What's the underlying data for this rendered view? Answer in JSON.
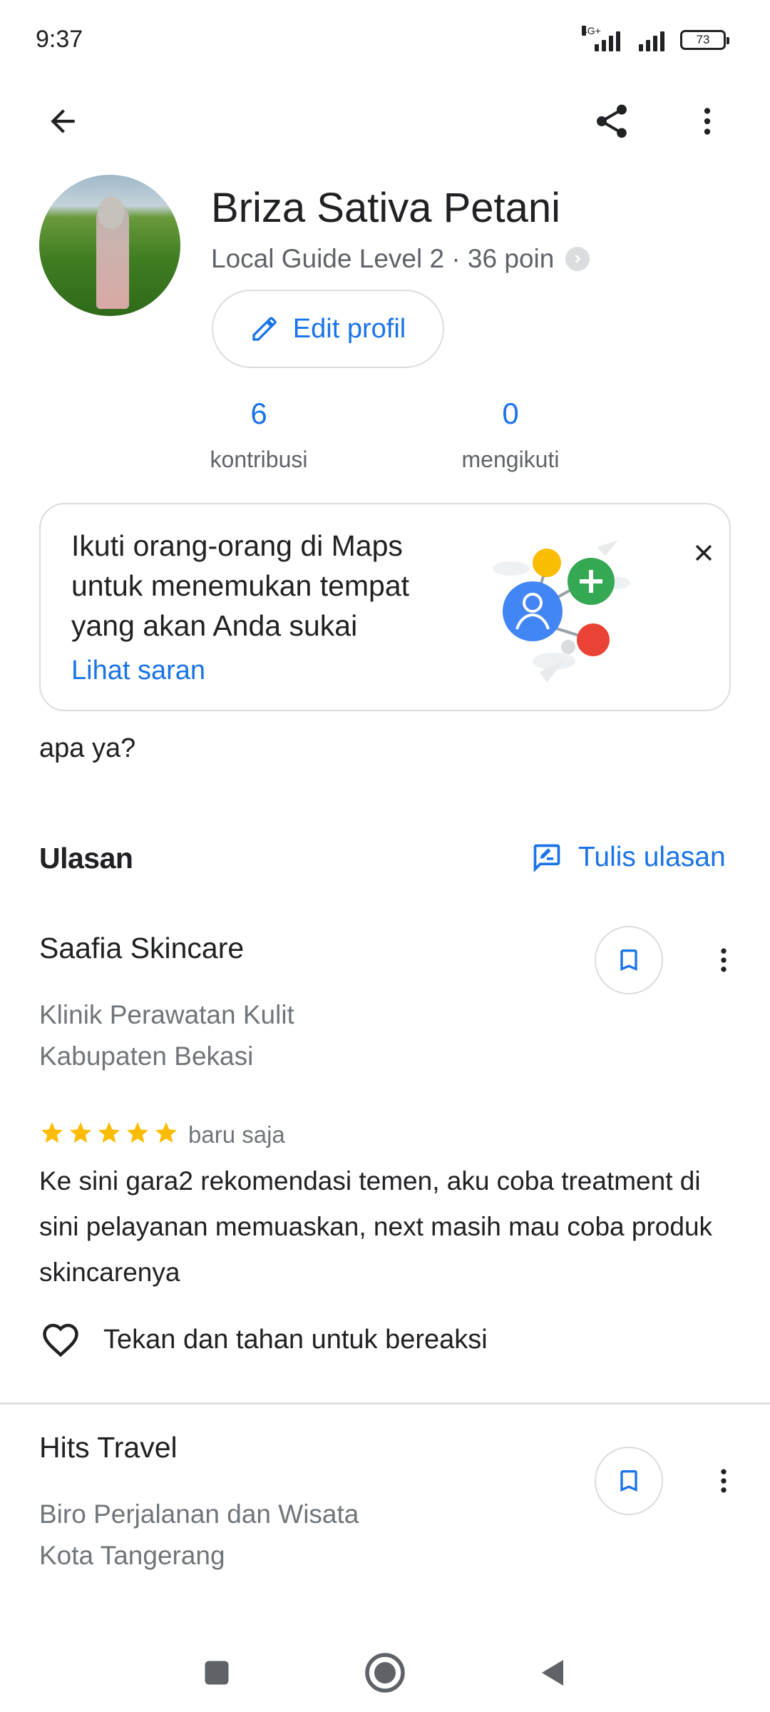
{
  "status_bar": {
    "time": "9:37",
    "network": "4G+",
    "battery": "73"
  },
  "profile": {
    "name": "Briza Sativa Petani",
    "level": "Local Guide Level 2 · 36 poin",
    "edit_label": "Edit profil",
    "stats": [
      {
        "value": "6",
        "label": "kontribusi"
      },
      {
        "value": "0",
        "label": "mengikuti"
      }
    ]
  },
  "suggestion": {
    "text": "Ikuti orang-orang di Maps untuk menemukan tempat yang akan Anda sukai",
    "link": "Lihat saran"
  },
  "bio": "apa ya?",
  "reviews_section": {
    "title": "Ulasan",
    "write_label": "Tulis ulasan",
    "reviews": [
      {
        "place": "Saafia Skincare",
        "category": "Klinik Perawatan Kulit",
        "location": "Kabupaten Bekasi",
        "rating": 5,
        "time": "baru saja",
        "text": "Ke sini gara2 rekomendasi temen, aku coba treatment di sini pelayanan memuaskan, next masih mau coba produk skincarenya",
        "react_label": "Tekan dan tahan untuk bereaksi"
      },
      {
        "place": "Hits Travel",
        "category": "Biro Perjalanan dan Wisata",
        "location": "Kota Tangerang"
      }
    ]
  },
  "colors": {
    "accent": "#1a73e8",
    "star": "#fbbc04",
    "text_primary": "#202124",
    "text_secondary": "#70757a"
  }
}
